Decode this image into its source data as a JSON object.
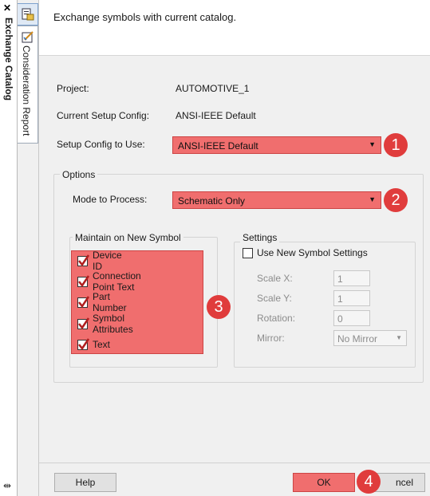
{
  "panel": {
    "title": "Exchange Catalog",
    "tab_consideration": "Consideration Report"
  },
  "header": {
    "description": "Exchange symbols with current catalog."
  },
  "info": {
    "project_label": "Project:",
    "project_value": "AUTOMOTIVE_1",
    "current_setup_label": "Current Setup Config:",
    "current_setup_value": "ANSI-IEEE Default",
    "setup_to_use_label": "Setup Config to Use:",
    "setup_to_use_value": "ANSI-IEEE Default"
  },
  "options": {
    "title": "Options",
    "mode_label": "Mode to Process:",
    "mode_value": "Schematic Only"
  },
  "maintain": {
    "title": "Maintain on New Symbol",
    "items": [
      {
        "label": "Device ID",
        "checked": true
      },
      {
        "label": "Connection Point Text",
        "checked": true
      },
      {
        "label": "Part Number",
        "checked": true
      },
      {
        "label": "Symbol Attributes",
        "checked": true
      },
      {
        "label": "Text",
        "checked": true
      }
    ]
  },
  "settings": {
    "title": "Settings",
    "use_new_label": "Use New Symbol Settings",
    "scale_x_label": "Scale X:",
    "scale_x_value": "1",
    "scale_y_label": "Scale Y:",
    "scale_y_value": "1",
    "rotation_label": "Rotation:",
    "rotation_value": "0",
    "mirror_label": "Mirror:",
    "mirror_value": "No Mirror"
  },
  "footer": {
    "help_label": "Help",
    "ok_label": "OK",
    "cancel_label": "ncel"
  },
  "callouts": [
    "1",
    "2",
    "3",
    "4"
  ],
  "colors": {
    "highlight": "#f06e6e",
    "badge": "#e03c3c",
    "check": "#c0392b"
  }
}
